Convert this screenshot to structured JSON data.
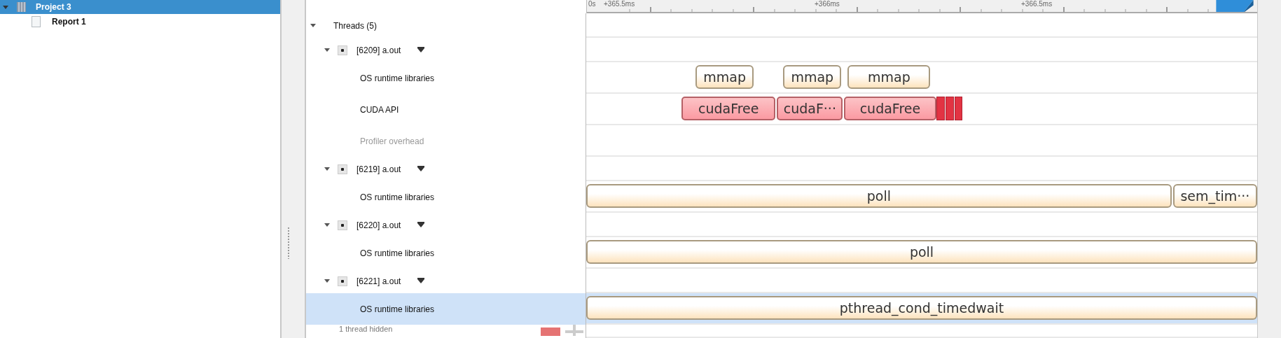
{
  "project_tree": [
    {
      "label": "Project 3",
      "selected": true,
      "expanded": true,
      "children": [
        {
          "label": "Report 1",
          "selected": false
        }
      ]
    }
  ],
  "timeline": {
    "ticks": [
      "0s",
      "+365.5ms",
      "+366ms",
      "+366.5ms"
    ]
  },
  "threads_group": {
    "label": "Threads (5)",
    "expanded": true,
    "threads": [
      {
        "label": "[6209] a.out",
        "expanded": true,
        "tracks": [
          {
            "label": "OS runtime libraries",
            "kind": "os",
            "selected": false,
            "disabled": false,
            "events": [
              {
                "kind": "call",
                "label": "mmap"
              },
              {
                "kind": "call",
                "label": "mmap"
              },
              {
                "kind": "call",
                "label": "mmap"
              }
            ]
          },
          {
            "label": "CUDA API",
            "kind": "cuda",
            "selected": false,
            "disabled": false,
            "events": [
              {
                "kind": "call",
                "label": "cudaFree"
              },
              {
                "kind": "call",
                "label": "cudaF···"
              },
              {
                "kind": "call",
                "label": "cudaFree"
              },
              {
                "kind": "marker"
              },
              {
                "kind": "marker"
              },
              {
                "kind": "marker"
              }
            ]
          },
          {
            "label": "Profiler overhead",
            "kind": "overhead",
            "selected": false,
            "disabled": true
          }
        ]
      },
      {
        "label": "[6219] a.out",
        "expanded": true,
        "tracks": [
          {
            "label": "OS runtime libraries",
            "kind": "os",
            "selected": false,
            "disabled": false,
            "events": [
              {
                "kind": "call",
                "label": "poll"
              },
              {
                "kind": "call",
                "label": "sem_tim···"
              }
            ]
          }
        ]
      },
      {
        "label": "[6220] a.out",
        "expanded": true,
        "tracks": [
          {
            "label": "OS runtime libraries",
            "kind": "os",
            "selected": false,
            "disabled": false,
            "events": [
              {
                "kind": "call",
                "label": "poll"
              }
            ]
          }
        ]
      },
      {
        "label": "[6221] a.out",
        "expanded": true,
        "tracks": [
          {
            "label": "OS runtime libraries",
            "kind": "os",
            "selected": true,
            "disabled": false,
            "events": [
              {
                "kind": "call",
                "label": "pthread_cond_timedwait"
              }
            ]
          }
        ]
      }
    ]
  },
  "hidden_note": "1 thread hidden"
}
